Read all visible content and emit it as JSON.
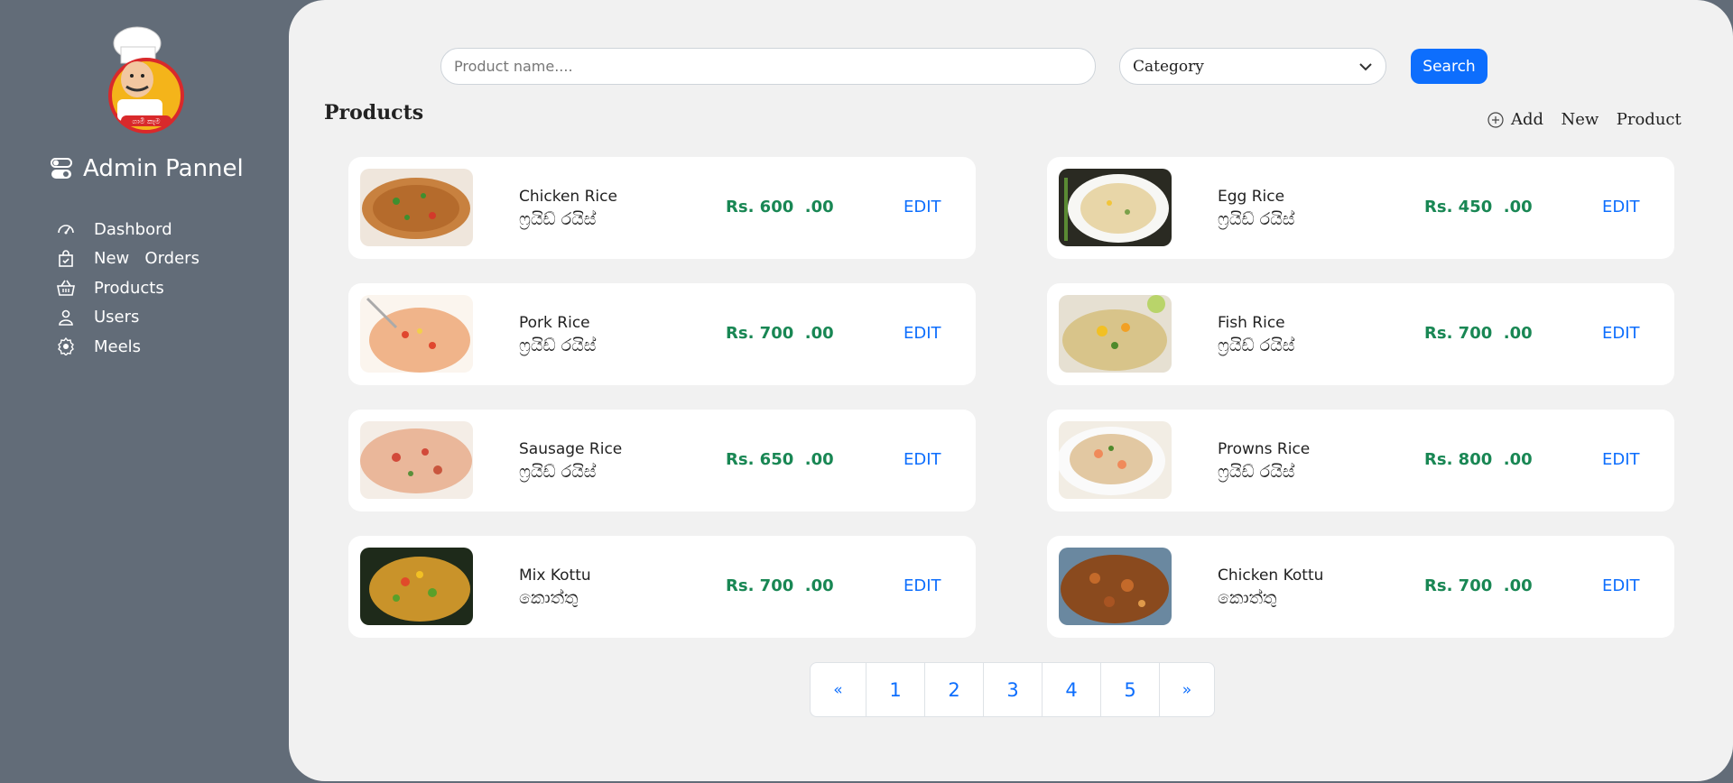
{
  "sidebar": {
    "brand": "Admin Pannel",
    "items": [
      {
        "label": "Dashbord",
        "icon": "speedometer-icon"
      },
      {
        "label": "New   Orders",
        "icon": "bag-check-icon"
      },
      {
        "label": "Products",
        "icon": "basket-icon"
      },
      {
        "label": "Users",
        "icon": "person-icon"
      },
      {
        "label": "Meels",
        "icon": "food-icon"
      }
    ]
  },
  "search": {
    "placeholder": "Product name....",
    "category_label": "Category",
    "button_label": "Search"
  },
  "main": {
    "title": "Products",
    "add_new_label": "Add  New  Product"
  },
  "products": [
    {
      "name": "Chicken Rice",
      "sname": "ෆ්‍රයිඩ් රයිස්",
      "price": "Rs. 600  .00",
      "edit": "EDIT"
    },
    {
      "name": "Egg Rice",
      "sname": "ෆ්‍රයිඩ් රයිස්",
      "price": "Rs. 450  .00",
      "edit": "EDIT"
    },
    {
      "name": "Pork Rice",
      "sname": "ෆ්‍රයිඩ් රයිස්",
      "price": "Rs. 700  .00",
      "edit": "EDIT"
    },
    {
      "name": "Fish Rice",
      "sname": "ෆ්‍රයිඩ් රයිස්",
      "price": "Rs. 700  .00",
      "edit": "EDIT"
    },
    {
      "name": "Sausage Rice",
      "sname": "ෆ්‍රයිඩ් රයිස්",
      "price": "Rs. 650  .00",
      "edit": "EDIT"
    },
    {
      "name": "Prowns Rice",
      "sname": "ෆ්‍රයිඩ් රයිස්",
      "price": "Rs. 800  .00",
      "edit": "EDIT"
    },
    {
      "name": "Mix Kottu",
      "sname": "කොත්තු",
      "price": "Rs. 700  .00",
      "edit": "EDIT"
    },
    {
      "name": "Chicken Kottu",
      "sname": "කොත්තු",
      "price": "Rs. 700  .00",
      "edit": "EDIT"
    }
  ],
  "pagination": [
    "«",
    "1",
    "2",
    "3",
    "4",
    "5",
    "»"
  ],
  "colors": {
    "sidebar_bg": "#626c78",
    "main_bg": "#f1f1f1",
    "accent": "#0d6efd",
    "price": "#198754"
  }
}
